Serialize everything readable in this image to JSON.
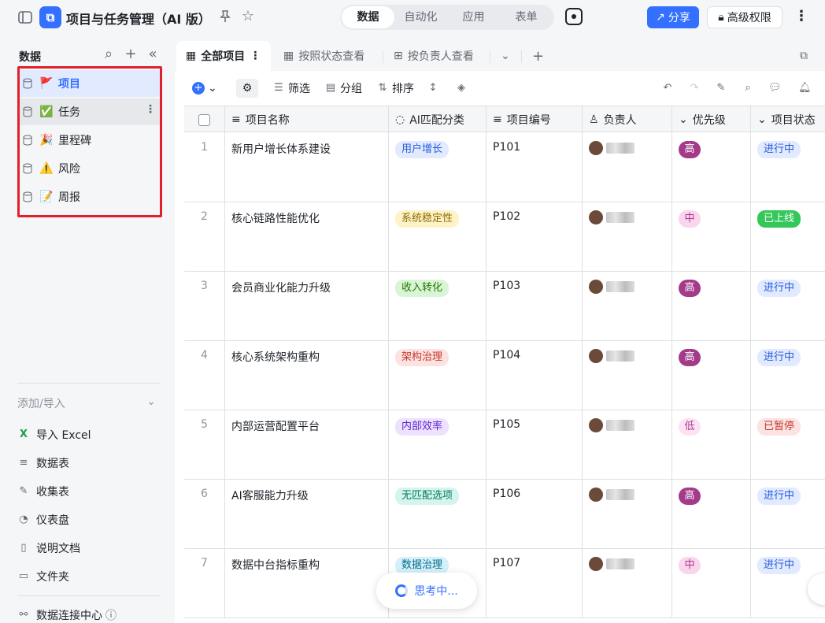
{
  "app": {
    "title": "项目与任务管理（AI 版）",
    "logo_icon": "bitable-logo-icon"
  },
  "topnav": {
    "tabs": [
      "数据",
      "自动化",
      "应用",
      "表单"
    ],
    "active": "数据"
  },
  "actions": {
    "share": "分享",
    "advanced": "高级权限"
  },
  "sidebar": {
    "title": "数据",
    "tables": [
      {
        "label": "项目",
        "emoji": "🚩",
        "selected": true
      },
      {
        "label": "任务",
        "emoji": "✅",
        "selected": false
      },
      {
        "label": "里程碑",
        "emoji": "🎉",
        "selected": false
      },
      {
        "label": "风险",
        "emoji": "⚠️",
        "selected": false
      },
      {
        "label": "周报",
        "emoji": "📝",
        "selected": false
      }
    ],
    "add_header": "添加/导入",
    "add_items": [
      "导入 Excel",
      "数据表",
      "收集表",
      "仪表盘",
      "说明文档",
      "文件夹"
    ],
    "connect": "数据连接中心"
  },
  "views": {
    "tabs": [
      "全部项目",
      "按照状态查看",
      "按负责人查看"
    ]
  },
  "toolbar": {
    "filter": "筛选",
    "group": "分组",
    "sort": "排序"
  },
  "columns": [
    "项目名称",
    "AI匹配分类",
    "项目编号",
    "负责人",
    "优先级",
    "项目状态"
  ],
  "rows": [
    {
      "n": "1",
      "name": "新用户增长体系建设",
      "cat": "用户增长",
      "catColor": "#e1eaff",
      "catText": "#245bdb",
      "code": "P101",
      "pri": "高",
      "priBg": "#a33b8a",
      "priFg": "#fff",
      "status": "进行中",
      "stBg": "#e1eaff",
      "stFg": "#245bdb"
    },
    {
      "n": "2",
      "name": "核心链路性能优化",
      "cat": "系统稳定性",
      "catColor": "#fdf3c7",
      "catText": "#8f6a00",
      "code": "P102",
      "pri": "中",
      "priBg": "#fbd4ee",
      "priFg": "#a33b8a",
      "status": "已上线",
      "stBg": "#34c759",
      "stFg": "#fff"
    },
    {
      "n": "3",
      "name": "会员商业化能力升级",
      "cat": "收入转化",
      "catColor": "#d9f5d6",
      "catText": "#237804",
      "code": "P103",
      "pri": "高",
      "priBg": "#a33b8a",
      "priFg": "#fff",
      "status": "进行中",
      "stBg": "#e1eaff",
      "stFg": "#245bdb"
    },
    {
      "n": "4",
      "name": "核心系统架构重构",
      "cat": "架构治理",
      "catColor": "#fde2e2",
      "catText": "#c2392b",
      "code": "P104",
      "pri": "高",
      "priBg": "#a33b8a",
      "priFg": "#fff",
      "status": "进行中",
      "stBg": "#e1eaff",
      "stFg": "#245bdb"
    },
    {
      "n": "5",
      "name": "内部运营配置平台",
      "cat": "内部效率",
      "catColor": "#ece2fe",
      "catText": "#6425d0",
      "code": "P105",
      "pri": "低",
      "priBg": "#fde2f4",
      "priFg": "#a33b8a",
      "status": "已暂停",
      "stBg": "#fde2e2",
      "stFg": "#c2392b"
    },
    {
      "n": "6",
      "name": "AI客服能力升级",
      "cat": "无匹配选项",
      "catColor": "#d4f5ee",
      "catText": "#077a5f",
      "code": "P106",
      "pri": "高",
      "priBg": "#a33b8a",
      "priFg": "#fff",
      "status": "进行中",
      "stBg": "#e1eaff",
      "stFg": "#245bdb"
    },
    {
      "n": "7",
      "name": "数据中台指标重构",
      "cat": "数据治理",
      "catColor": "#d4f1fb",
      "catText": "#0a6b8a",
      "code": "P107",
      "pri": "中",
      "priBg": "#fbd4ee",
      "priFg": "#a33b8a",
      "status": "进行中",
      "stBg": "#e1eaff",
      "stFg": "#245bdb"
    }
  ],
  "floating": {
    "thinking": "思考中..."
  }
}
